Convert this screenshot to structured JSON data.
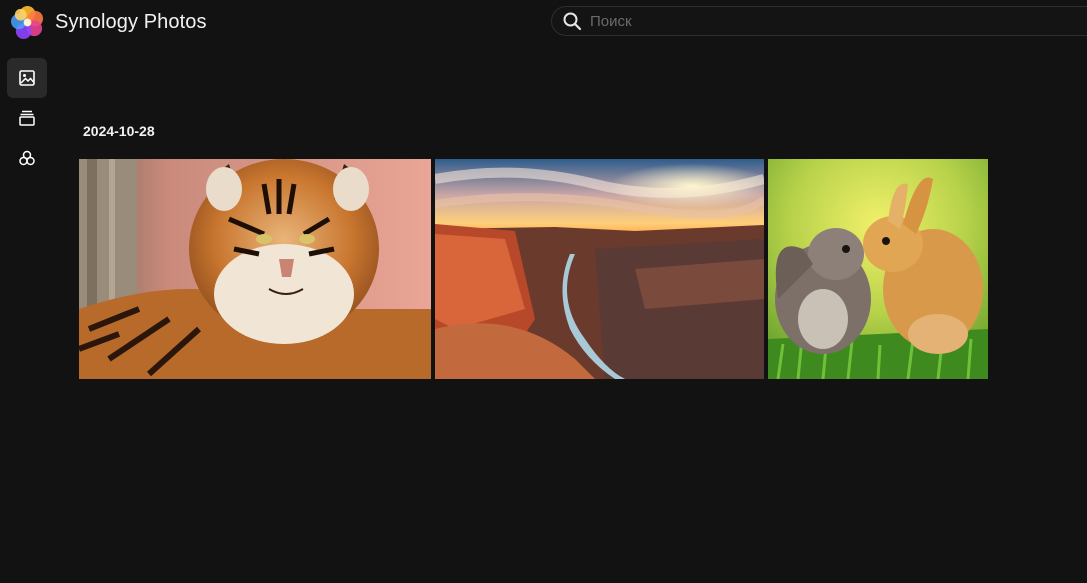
{
  "app": {
    "title": "Synology Photos",
    "logo_icon": "synology-photos-flower-logo"
  },
  "search": {
    "placeholder": "Поиск",
    "value": "",
    "icon": "search-icon"
  },
  "sidebar": {
    "items": [
      {
        "icon": "photos-icon",
        "active": true
      },
      {
        "icon": "albums-icon",
        "active": false
      },
      {
        "icon": "shared-space-icon",
        "active": false
      }
    ]
  },
  "timeline": {
    "groups": [
      {
        "date": "2024-10-28",
        "photos": [
          {
            "subject": "tiger"
          },
          {
            "subject": "canyon-sunset"
          },
          {
            "subject": "rabbits"
          }
        ]
      }
    ]
  },
  "colors": {
    "background": "#121212",
    "text": "#ffffff",
    "search_border": "#2e2e2e",
    "active_rail": "#2a2a2a"
  }
}
